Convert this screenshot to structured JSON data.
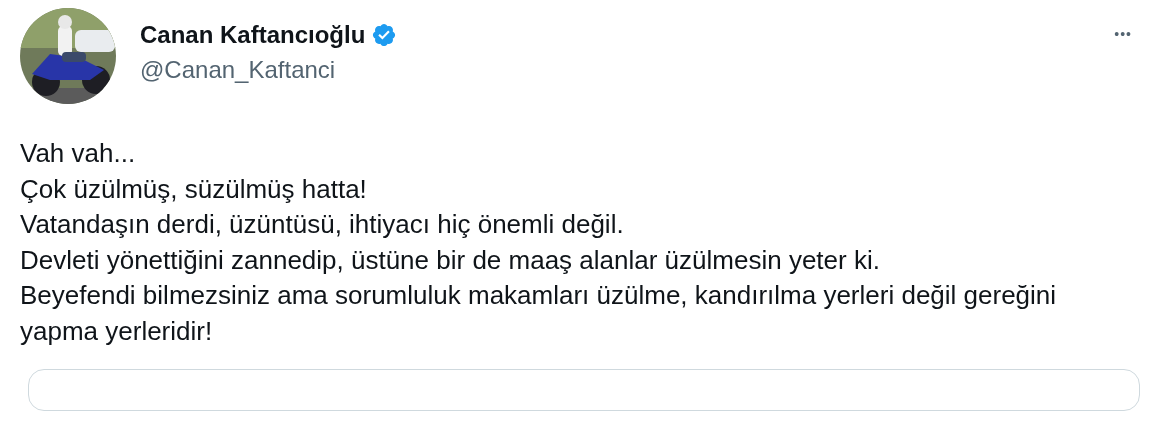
{
  "author": {
    "name": "Canan Kaftancıoğlu",
    "verified": true,
    "handle": "@Canan_Kaftanci"
  },
  "more_button": {
    "label": "•••"
  },
  "tweet_lines": [
    "Vah vah...",
    "Çok üzülmüş, süzülmüş hatta!",
    "Vatandaşın derdi, üzüntüsü, ihtiyacı hiç önemli değil.",
    "Devleti yönettiğini zannedip, üstüne bir de maaş alanlar üzülmesin yeter ki.",
    "Beyefendi bilmezsiniz ama sorumluluk makamları üzülme, kandırılma yerleri değil gereğini yapma yerleridir!"
  ],
  "quoted_card": {
    "kind": "card"
  }
}
